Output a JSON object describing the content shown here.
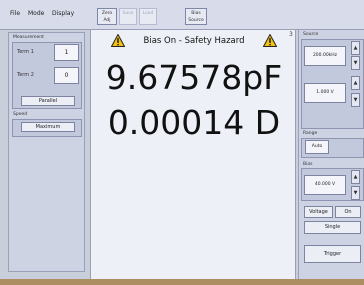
{
  "menu": {
    "file": "File",
    "mode": "Mode",
    "display": "Display"
  },
  "toolbar": {
    "b1_line1": "Zero",
    "b1_line2": "Adj",
    "b2_line1": "Save",
    "b2_line2": "",
    "b3_line1": "Load",
    "b3_line2": "",
    "b4_line1": "Bias",
    "b4_line2": "Source"
  },
  "left": {
    "measurement_title": "Measurement",
    "term1_label": "Term 1",
    "term1_value": "1",
    "term2_label": "Term 2",
    "term2_value": "0",
    "parallel_label": "Parallel",
    "speed_title": "Speed",
    "speed_value": "Maximum"
  },
  "display": {
    "warning": "Bias On - Safety Hazard",
    "primary": "9.67578pF",
    "secondary": "0.00014 D",
    "corner": "3"
  },
  "right": {
    "source_title": "Source",
    "frequency_value": "200.00kHz",
    "level_value": "1.000 V",
    "range_title": "Range",
    "range_value": "Auto",
    "bias_title": "Bias",
    "bias_value": "40.000 V",
    "voltage_label": "Voltage",
    "on_label": "On",
    "single_label": "Single",
    "trigger_label": "Trigger"
  },
  "icons": {
    "warning": "warning-triangle-icon",
    "up": "up-arrow-icon",
    "down": "down-arrow-icon"
  }
}
